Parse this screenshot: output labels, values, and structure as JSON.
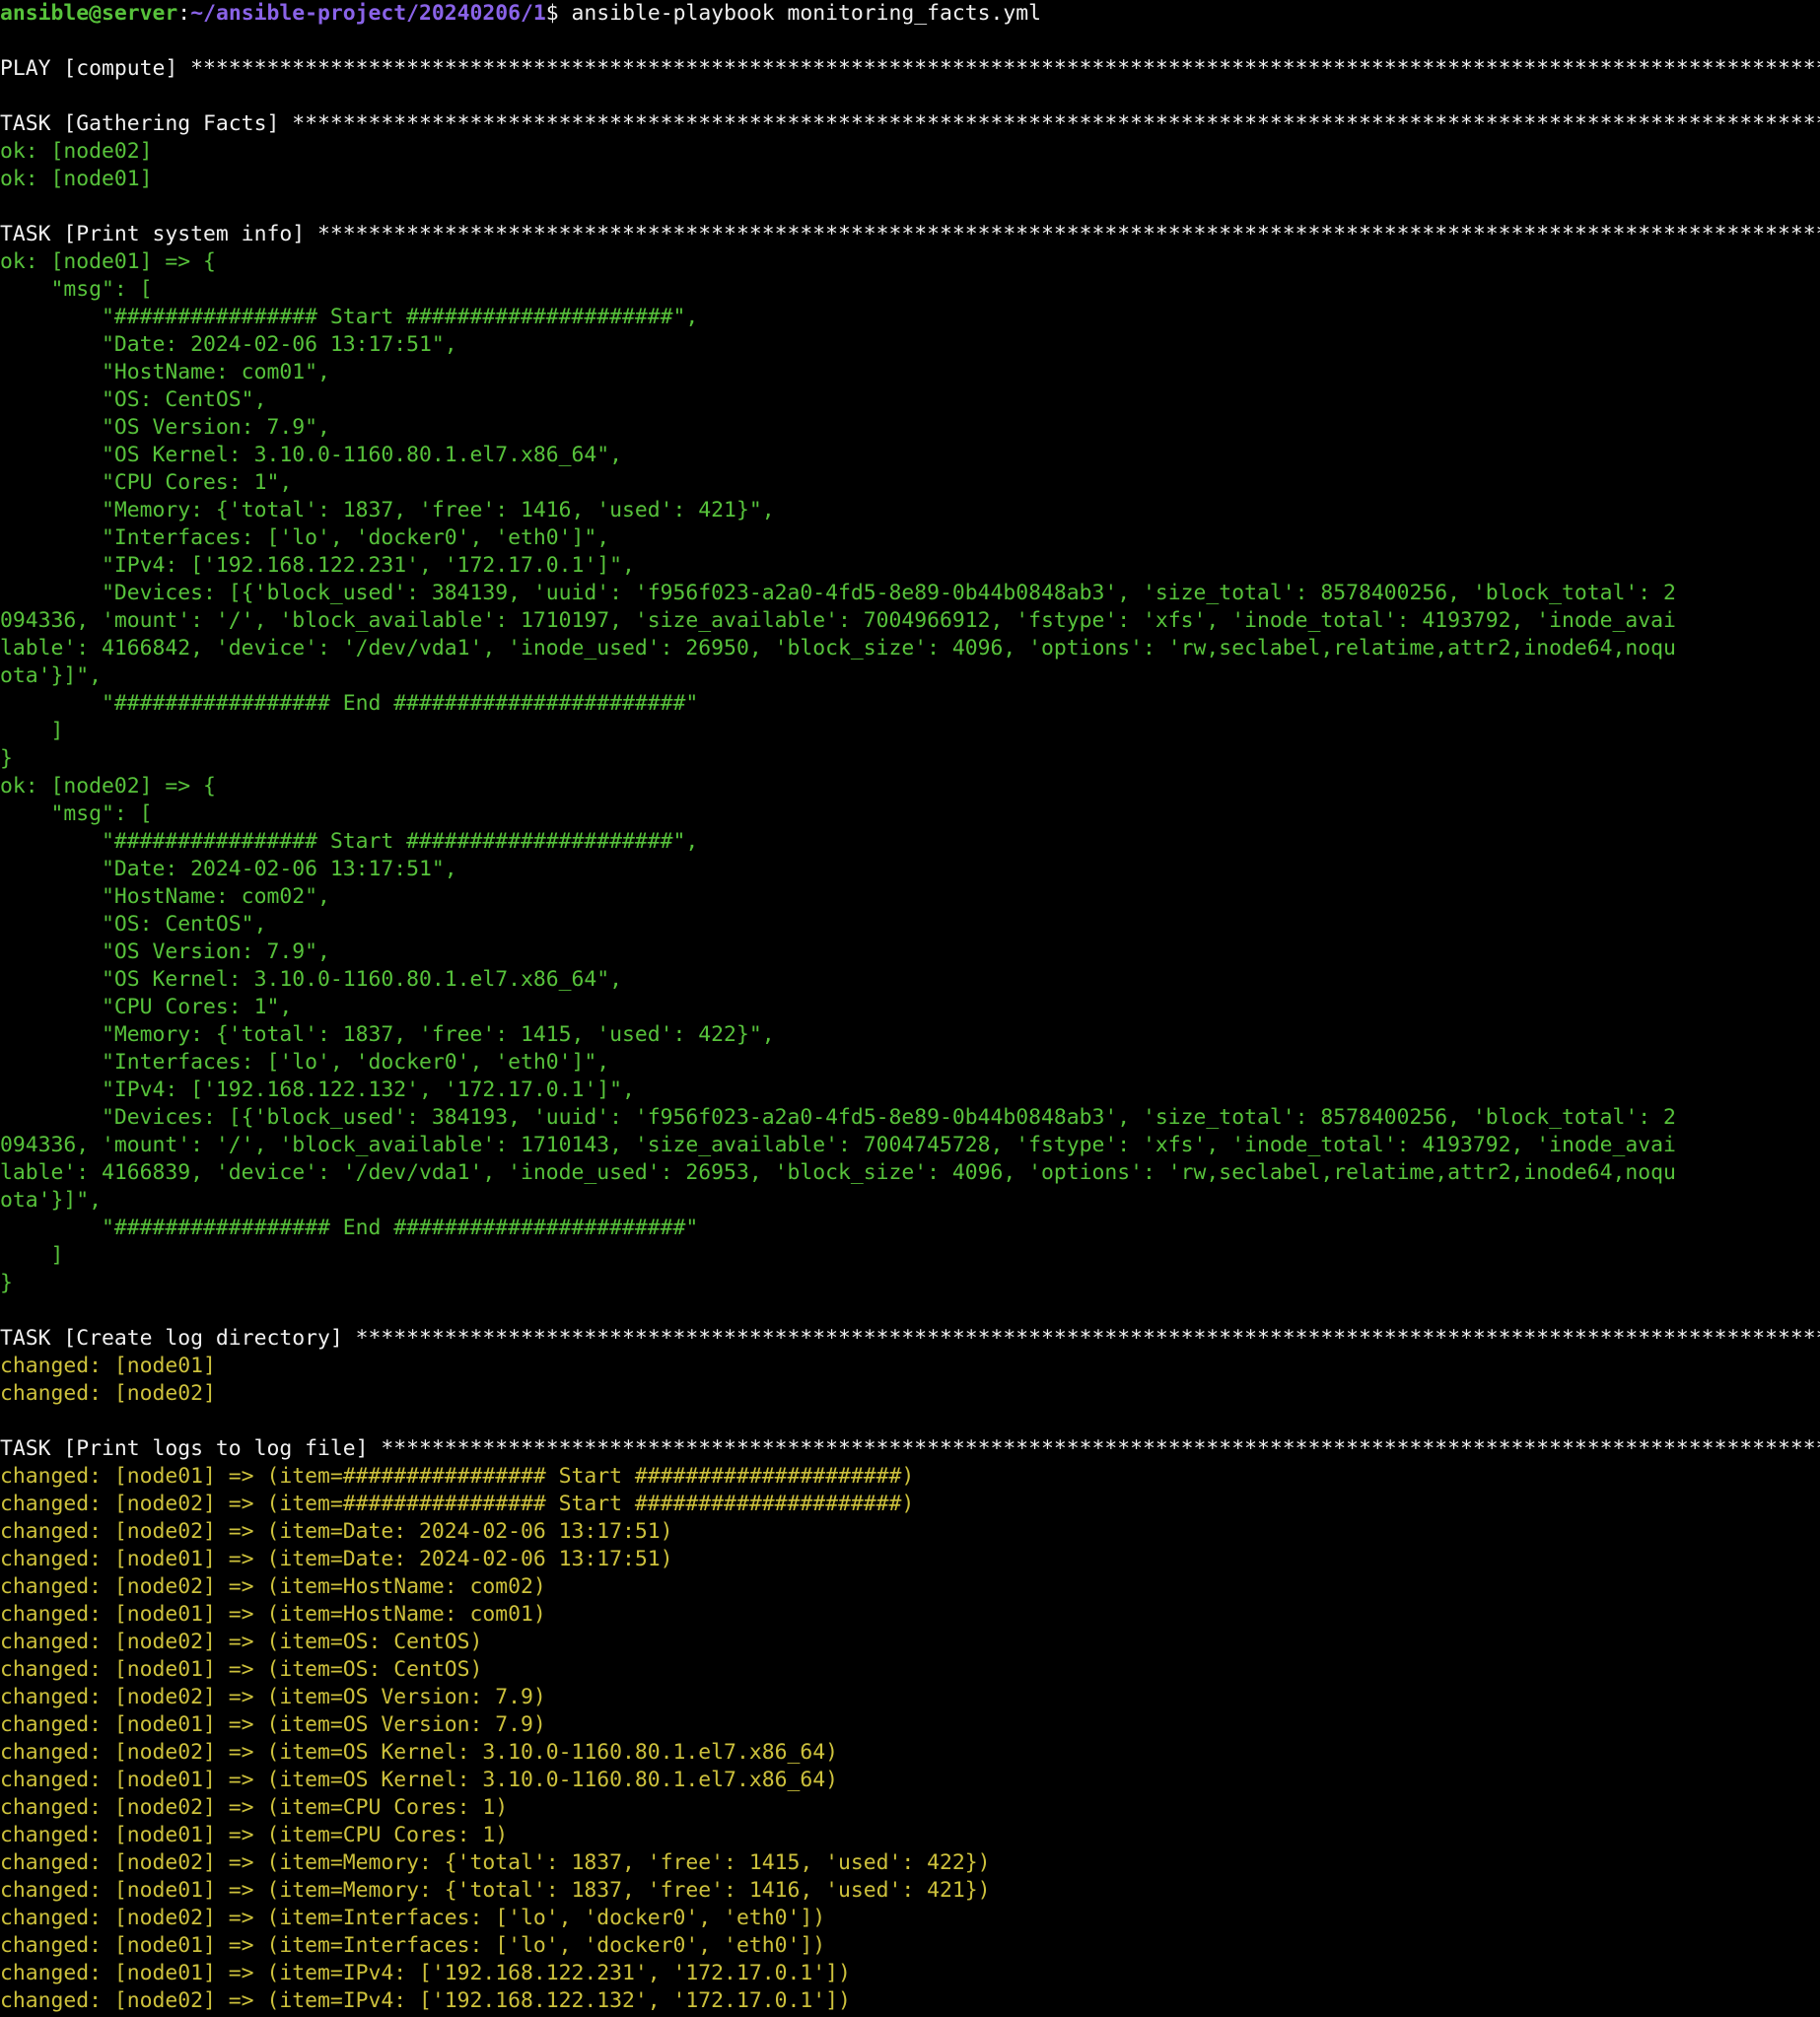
{
  "colors": {
    "background": "#000000",
    "default": "#f0f0f0",
    "ok": "#57c23b",
    "changed": "#cdc13c",
    "prompt_user": "#57c23b",
    "prompt_path": "#8a63e8"
  },
  "prompt": {
    "user_host": "ansible@server",
    "separator": ":",
    "path": "~/ansible-project/20240206/1",
    "symbol": "$",
    "command": " ansible-playbook monitoring_facts.yml"
  },
  "lines": [
    {
      "c": "white",
      "t": ""
    },
    {
      "c": "white",
      "t": "PLAY [compute] **********************************************************************************************************************************************************************"
    },
    {
      "c": "white",
      "t": ""
    },
    {
      "c": "white",
      "t": "TASK [Gathering Facts] **************************************************************************************************************************************************************"
    },
    {
      "c": "green",
      "t": "ok: [node02]"
    },
    {
      "c": "green",
      "t": "ok: [node01]"
    },
    {
      "c": "white",
      "t": ""
    },
    {
      "c": "white",
      "t": "TASK [Print system info] ************************************************************************************************************************************************************"
    },
    {
      "c": "green",
      "t": "ok: [node01] => {"
    },
    {
      "c": "green",
      "t": "    \"msg\": ["
    },
    {
      "c": "green",
      "t": "        \"################ Start #####################\","
    },
    {
      "c": "green",
      "t": "        \"Date: 2024-02-06 13:17:51\","
    },
    {
      "c": "green",
      "t": "        \"HostName: com01\","
    },
    {
      "c": "green",
      "t": "        \"OS: CentOS\","
    },
    {
      "c": "green",
      "t": "        \"OS Version: 7.9\","
    },
    {
      "c": "green",
      "t": "        \"OS Kernel: 3.10.0-1160.80.1.el7.x86_64\","
    },
    {
      "c": "green",
      "t": "        \"CPU Cores: 1\","
    },
    {
      "c": "green",
      "t": "        \"Memory: {'total': 1837, 'free': 1416, 'used': 421}\","
    },
    {
      "c": "green",
      "t": "        \"Interfaces: ['lo', 'docker0', 'eth0']\","
    },
    {
      "c": "green",
      "t": "        \"IPv4: ['192.168.122.231', '172.17.0.1']\","
    },
    {
      "c": "green",
      "t": "        \"Devices: [{'block_used': 384139, 'uuid': 'f956f023-a2a0-4fd5-8e89-0b44b0848ab3', 'size_total': 8578400256, 'block_total': 2"
    },
    {
      "c": "green",
      "t": "094336, 'mount': '/', 'block_available': 1710197, 'size_available': 7004966912, 'fstype': 'xfs', 'inode_total': 4193792, 'inode_avai"
    },
    {
      "c": "green",
      "t": "lable': 4166842, 'device': '/dev/vda1', 'inode_used': 26950, 'block_size': 4096, 'options': 'rw,seclabel,relatime,attr2,inode64,noqu"
    },
    {
      "c": "green",
      "t": "ota'}]\","
    },
    {
      "c": "green",
      "t": "        \"################# End #######################\""
    },
    {
      "c": "green",
      "t": "    ]"
    },
    {
      "c": "green",
      "t": "}"
    },
    {
      "c": "green",
      "t": "ok: [node02] => {"
    },
    {
      "c": "green",
      "t": "    \"msg\": ["
    },
    {
      "c": "green",
      "t": "        \"################ Start #####################\","
    },
    {
      "c": "green",
      "t": "        \"Date: 2024-02-06 13:17:51\","
    },
    {
      "c": "green",
      "t": "        \"HostName: com02\","
    },
    {
      "c": "green",
      "t": "        \"OS: CentOS\","
    },
    {
      "c": "green",
      "t": "        \"OS Version: 7.9\","
    },
    {
      "c": "green",
      "t": "        \"OS Kernel: 3.10.0-1160.80.1.el7.x86_64\","
    },
    {
      "c": "green",
      "t": "        \"CPU Cores: 1\","
    },
    {
      "c": "green",
      "t": "        \"Memory: {'total': 1837, 'free': 1415, 'used': 422}\","
    },
    {
      "c": "green",
      "t": "        \"Interfaces: ['lo', 'docker0', 'eth0']\","
    },
    {
      "c": "green",
      "t": "        \"IPv4: ['192.168.122.132', '172.17.0.1']\","
    },
    {
      "c": "green",
      "t": "        \"Devices: [{'block_used': 384193, 'uuid': 'f956f023-a2a0-4fd5-8e89-0b44b0848ab3', 'size_total': 8578400256, 'block_total': 2"
    },
    {
      "c": "green",
      "t": "094336, 'mount': '/', 'block_available': 1710143, 'size_available': 7004745728, 'fstype': 'xfs', 'inode_total': 4193792, 'inode_avai"
    },
    {
      "c": "green",
      "t": "lable': 4166839, 'device': '/dev/vda1', 'inode_used': 26953, 'block_size': 4096, 'options': 'rw,seclabel,relatime,attr2,inode64,noqu"
    },
    {
      "c": "green",
      "t": "ota'}]\","
    },
    {
      "c": "green",
      "t": "        \"################# End #######################\""
    },
    {
      "c": "green",
      "t": "    ]"
    },
    {
      "c": "green",
      "t": "}"
    },
    {
      "c": "white",
      "t": ""
    },
    {
      "c": "white",
      "t": "TASK [Create log directory] *********************************************************************************************************************************************************"
    },
    {
      "c": "yellow",
      "t": "changed: [node01]"
    },
    {
      "c": "yellow",
      "t": "changed: [node02]"
    },
    {
      "c": "white",
      "t": ""
    },
    {
      "c": "white",
      "t": "TASK [Print logs to log file] *******************************************************************************************************************************************************"
    },
    {
      "c": "yellow",
      "t": "changed: [node01] => (item=################ Start #####################)"
    },
    {
      "c": "yellow",
      "t": "changed: [node02] => (item=################ Start #####################)"
    },
    {
      "c": "yellow",
      "t": "changed: [node02] => (item=Date: 2024-02-06 13:17:51)"
    },
    {
      "c": "yellow",
      "t": "changed: [node01] => (item=Date: 2024-02-06 13:17:51)"
    },
    {
      "c": "yellow",
      "t": "changed: [node02] => (item=HostName: com02)"
    },
    {
      "c": "yellow",
      "t": "changed: [node01] => (item=HostName: com01)"
    },
    {
      "c": "yellow",
      "t": "changed: [node02] => (item=OS: CentOS)"
    },
    {
      "c": "yellow",
      "t": "changed: [node01] => (item=OS: CentOS)"
    },
    {
      "c": "yellow",
      "t": "changed: [node02] => (item=OS Version: 7.9)"
    },
    {
      "c": "yellow",
      "t": "changed: [node01] => (item=OS Version: 7.9)"
    },
    {
      "c": "yellow",
      "t": "changed: [node02] => (item=OS Kernel: 3.10.0-1160.80.1.el7.x86_64)"
    },
    {
      "c": "yellow",
      "t": "changed: [node01] => (item=OS Kernel: 3.10.0-1160.80.1.el7.x86_64)"
    },
    {
      "c": "yellow",
      "t": "changed: [node02] => (item=CPU Cores: 1)"
    },
    {
      "c": "yellow",
      "t": "changed: [node01] => (item=CPU Cores: 1)"
    },
    {
      "c": "yellow",
      "t": "changed: [node02] => (item=Memory: {'total': 1837, 'free': 1415, 'used': 422})"
    },
    {
      "c": "yellow",
      "t": "changed: [node01] => (item=Memory: {'total': 1837, 'free': 1416, 'used': 421})"
    },
    {
      "c": "yellow",
      "t": "changed: [node02] => (item=Interfaces: ['lo', 'docker0', 'eth0'])"
    },
    {
      "c": "yellow",
      "t": "changed: [node01] => (item=Interfaces: ['lo', 'docker0', 'eth0'])"
    },
    {
      "c": "yellow",
      "t": "changed: [node01] => (item=IPv4: ['192.168.122.231', '172.17.0.1'])"
    },
    {
      "c": "yellow",
      "t": "changed: [node02] => (item=IPv4: ['192.168.122.132', '172.17.0.1'])"
    }
  ]
}
